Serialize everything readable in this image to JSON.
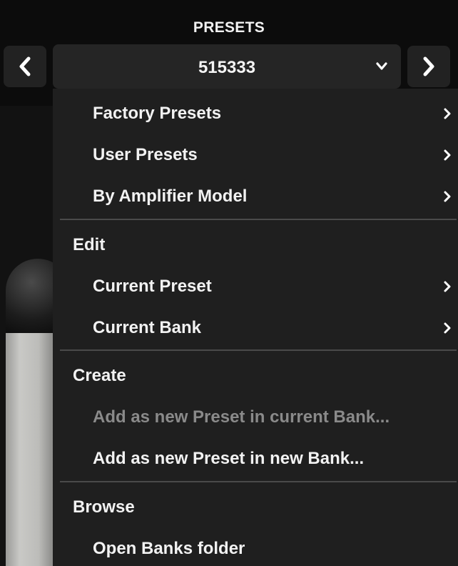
{
  "header": {
    "title": "PRESETS",
    "prev_icon": "chevron-left-icon",
    "next_icon": "chevron-right-icon"
  },
  "preset_selector": {
    "value": "515333",
    "icon": "chevron-down-icon"
  },
  "menu": {
    "browse_items": [
      {
        "label": "Factory Presets",
        "submenu": true
      },
      {
        "label": "User Presets",
        "submenu": true
      },
      {
        "label": "By Amplifier Model",
        "submenu": true
      }
    ],
    "edit": {
      "heading": "Edit",
      "items": [
        {
          "label": "Current Preset",
          "submenu": true
        },
        {
          "label": "Current Bank",
          "submenu": true
        }
      ]
    },
    "create": {
      "heading": "Create",
      "items": [
        {
          "label": "Add as new Preset in current Bank...",
          "disabled": true
        },
        {
          "label": "Add as new Preset in new Bank...",
          "disabled": false
        }
      ]
    },
    "browse": {
      "heading": "Browse",
      "items": [
        {
          "label": "Open Banks folder"
        }
      ]
    }
  },
  "colors": {
    "background": "#0b0b0b",
    "menu": "#1f1f1f",
    "text": "#f2f2f2",
    "disabled_text": "#8a8a8a",
    "divider": "#4a4a4a"
  }
}
